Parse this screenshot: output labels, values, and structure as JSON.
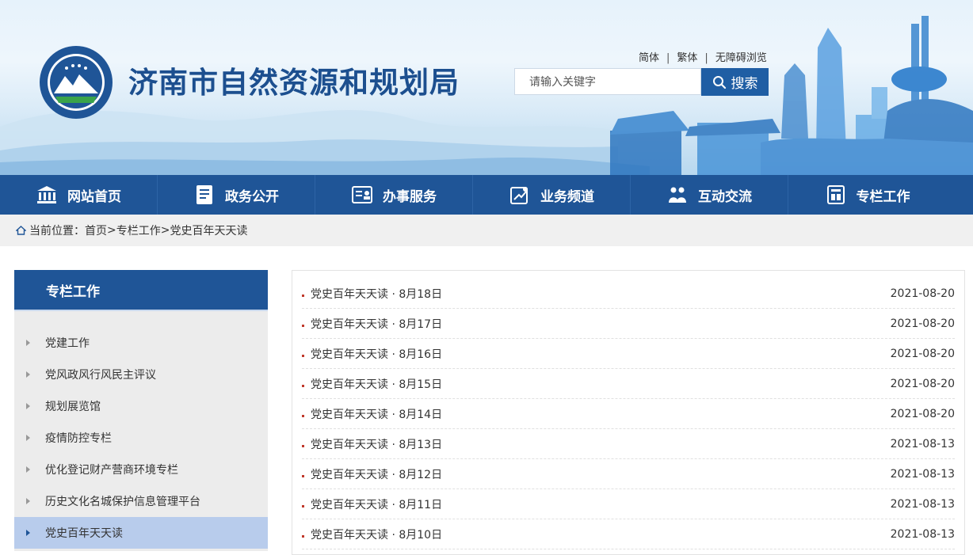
{
  "site_title": "济南市自然资源和规划局",
  "lang_links": [
    "简体",
    "繁体",
    "无障碍浏览"
  ],
  "search": {
    "placeholder": "请输入关键字",
    "button_label": "搜索"
  },
  "nav": [
    {
      "label": "网站首页",
      "icon": "bank-icon"
    },
    {
      "label": "政务公开",
      "icon": "document-icon"
    },
    {
      "label": "办事服务",
      "icon": "service-icon"
    },
    {
      "label": "业务频道",
      "icon": "map-icon"
    },
    {
      "label": "互动交流",
      "icon": "people-icon"
    },
    {
      "label": "专栏工作",
      "icon": "column-icon"
    }
  ],
  "breadcrumb": {
    "prefix": "当前位置：",
    "items": [
      "首页",
      "专栏工作",
      "党史百年天天读"
    ],
    "separator": ">"
  },
  "sidebar": {
    "title": "专栏工作",
    "items": [
      {
        "label": "党建工作",
        "active": false
      },
      {
        "label": "党风政风行风民主评议",
        "active": false
      },
      {
        "label": "规划展览馆",
        "active": false
      },
      {
        "label": "疫情防控专栏",
        "active": false
      },
      {
        "label": "优化登记财产营商环境专栏",
        "active": false
      },
      {
        "label": "历史文化名城保护信息管理平台",
        "active": false
      },
      {
        "label": "党史百年天天读",
        "active": true
      }
    ]
  },
  "news": [
    {
      "title": "党史百年天天读 · 8月18日",
      "date": "2021-08-20"
    },
    {
      "title": "党史百年天天读 · 8月17日",
      "date": "2021-08-20"
    },
    {
      "title": "党史百年天天读 · 8月16日",
      "date": "2021-08-20"
    },
    {
      "title": "党史百年天天读 · 8月15日",
      "date": "2021-08-20"
    },
    {
      "title": "党史百年天天读 · 8月14日",
      "date": "2021-08-20"
    },
    {
      "title": "党史百年天天读 · 8月13日",
      "date": "2021-08-13"
    },
    {
      "title": "党史百年天天读 · 8月12日",
      "date": "2021-08-13"
    },
    {
      "title": "党史百年天天读 · 8月11日",
      "date": "2021-08-13"
    },
    {
      "title": "党史百年天天读 · 8月10日",
      "date": "2021-08-13"
    }
  ],
  "colors": {
    "primary": "#1f5597",
    "accent_blue": "#1f5ea4",
    "bullet": "#c0392b",
    "active_side": "#b8ccec"
  }
}
